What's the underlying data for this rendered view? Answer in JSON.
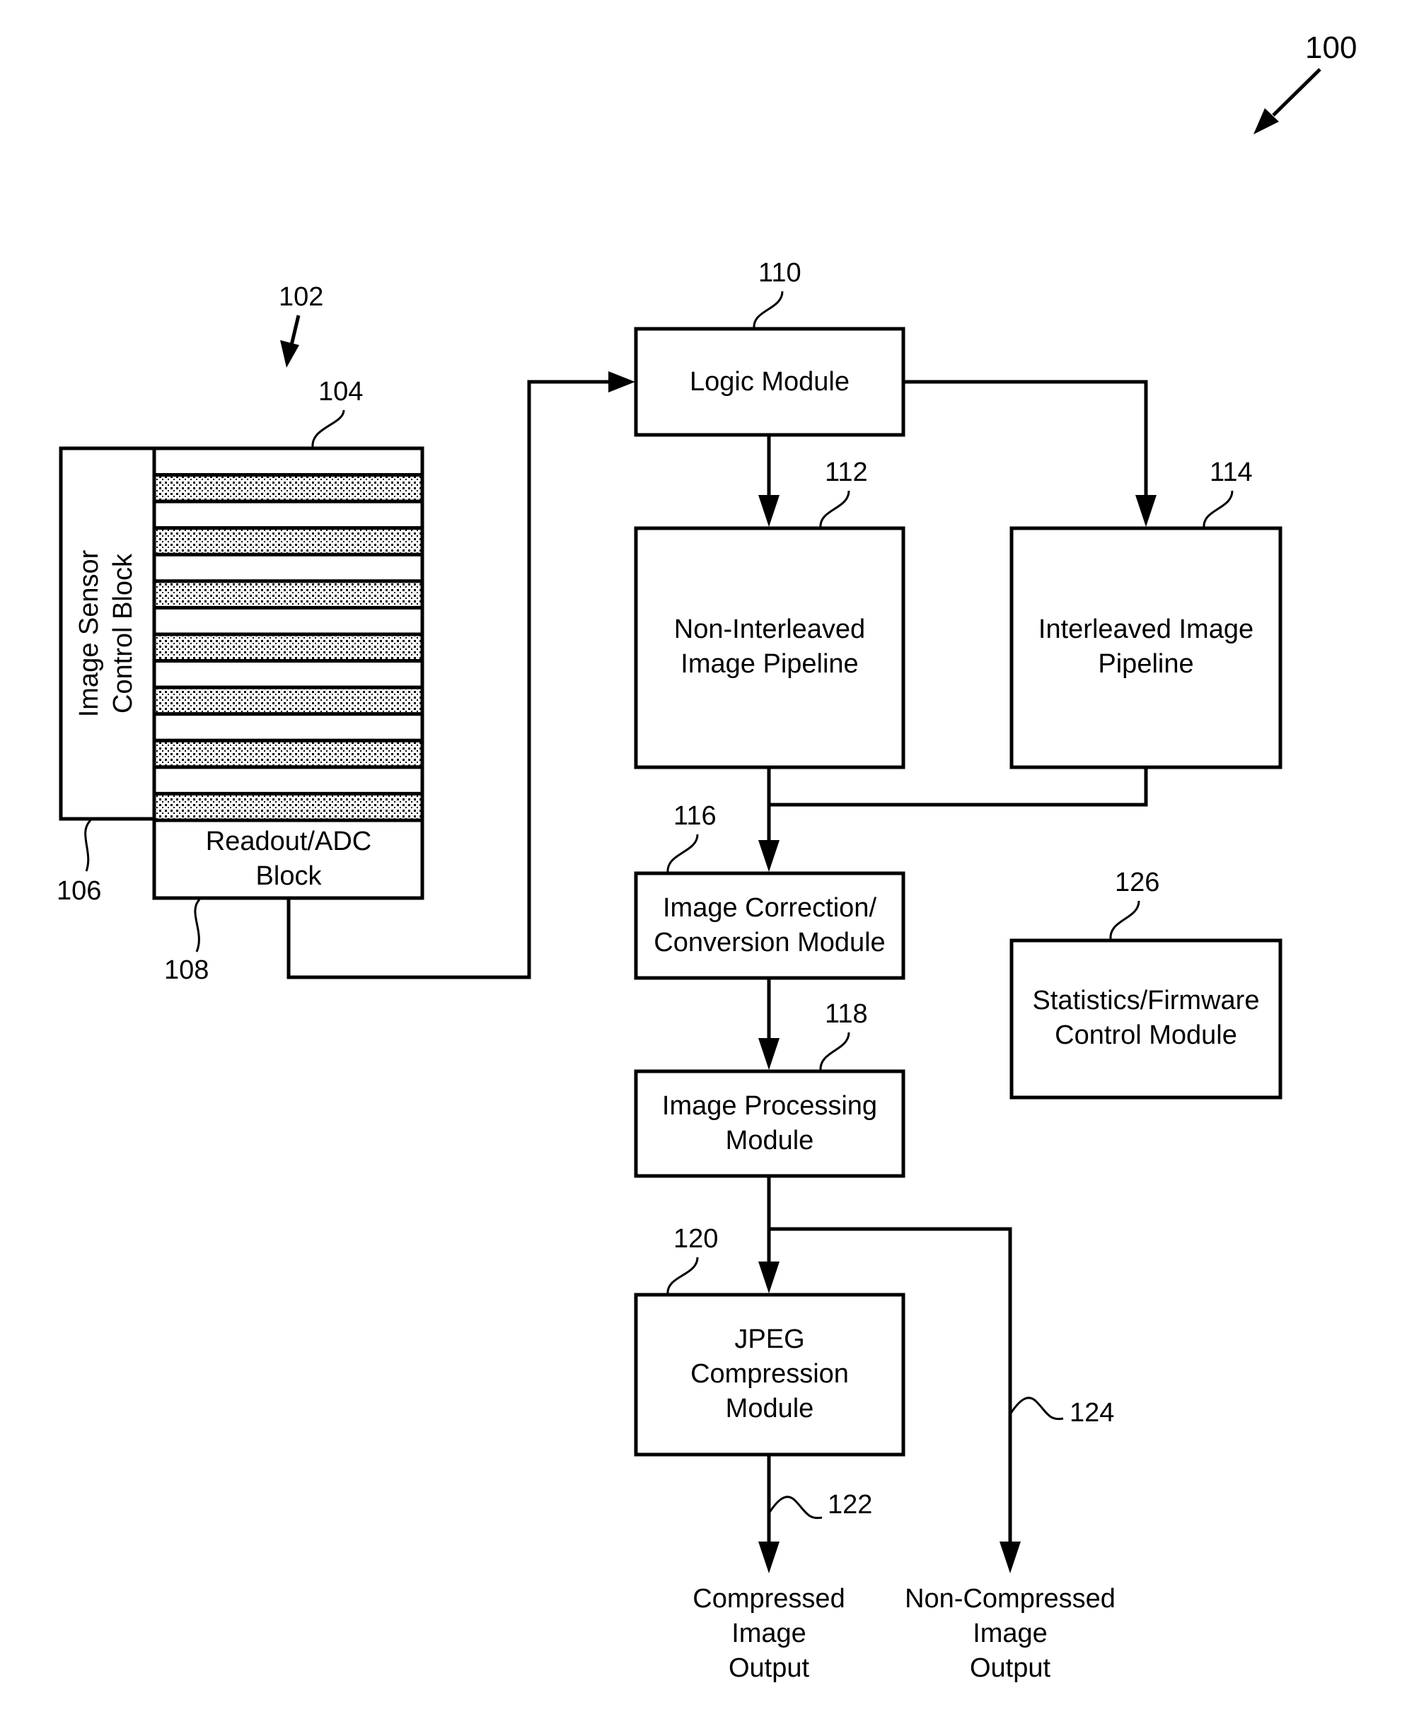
{
  "figure": {
    "ref": "100",
    "sensor_assembly_ref": "102"
  },
  "blocks": {
    "pixel_array": {
      "ref": "104",
      "row_count": 14,
      "pattern": [
        "clear",
        "stippled"
      ]
    },
    "control_block": {
      "ref": "106",
      "lines": [
        "Image Sensor",
        "Control Block"
      ]
    },
    "readout_block": {
      "ref": "108",
      "lines": [
        "Readout/ADC",
        "Block"
      ]
    },
    "logic_module": {
      "ref": "110",
      "lines": [
        "Logic Module"
      ]
    },
    "non_interleaved_pipeline": {
      "ref": "112",
      "lines": [
        "Non-Interleaved",
        "Image Pipeline"
      ]
    },
    "interleaved_pipeline": {
      "ref": "114",
      "lines": [
        "Interleaved Image",
        "Pipeline"
      ]
    },
    "correction_module": {
      "ref": "116",
      "lines": [
        "Image Correction/",
        "Conversion Module"
      ]
    },
    "processing_module": {
      "ref": "118",
      "lines": [
        "Image Processing",
        "Module"
      ]
    },
    "jpeg_module": {
      "ref": "120",
      "lines": [
        "JPEG",
        "Compression",
        "Module"
      ]
    },
    "stats_module": {
      "ref": "126",
      "lines": [
        "Statistics/Firmware",
        "Control Module"
      ]
    }
  },
  "outputs": {
    "compressed": {
      "ref": "122",
      "lines": [
        "Compressed",
        "Image",
        "Output"
      ]
    },
    "non_compressed": {
      "ref": "124",
      "lines": [
        "Non-Compressed",
        "Image",
        "Output"
      ]
    }
  },
  "colors": {
    "ink": "#000000",
    "paper": "#ffffff"
  }
}
